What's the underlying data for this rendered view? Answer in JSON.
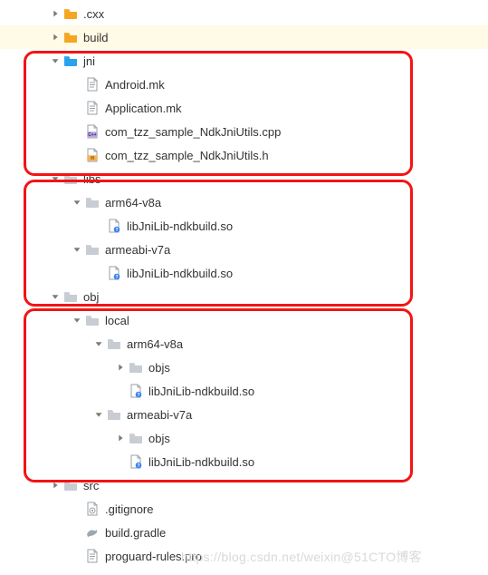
{
  "tree": [
    {
      "depth": 1,
      "toggle": "right",
      "iconKind": "folder-orange",
      "label": ".cxx",
      "interactable": true,
      "highlight": false
    },
    {
      "depth": 1,
      "toggle": "right",
      "iconKind": "folder-orange",
      "label": "build",
      "interactable": true,
      "highlight": true
    },
    {
      "depth": 1,
      "toggle": "down",
      "iconKind": "folder-blue",
      "label": "jni",
      "interactable": true,
      "highlight": false
    },
    {
      "depth": 2,
      "toggle": "none",
      "iconKind": "file-text",
      "label": "Android.mk",
      "interactable": true
    },
    {
      "depth": 2,
      "toggle": "none",
      "iconKind": "file-text",
      "label": "Application.mk",
      "interactable": true
    },
    {
      "depth": 2,
      "toggle": "none",
      "iconKind": "file-cpp",
      "label": "com_tzz_sample_NdkJniUtils.cpp",
      "interactable": true
    },
    {
      "depth": 2,
      "toggle": "none",
      "iconKind": "file-h",
      "label": "com_tzz_sample_NdkJniUtils.h",
      "interactable": true
    },
    {
      "depth": 1,
      "toggle": "down",
      "iconKind": "folder-grey",
      "label": "libs",
      "interactable": true
    },
    {
      "depth": 2,
      "toggle": "down",
      "iconKind": "folder-grey",
      "label": "arm64-v8a",
      "interactable": true
    },
    {
      "depth": 3,
      "toggle": "none",
      "iconKind": "file-so",
      "label": "libJniLib-ndkbuild.so",
      "interactable": true
    },
    {
      "depth": 2,
      "toggle": "down",
      "iconKind": "folder-grey",
      "label": "armeabi-v7a",
      "interactable": true
    },
    {
      "depth": 3,
      "toggle": "none",
      "iconKind": "file-so",
      "label": "libJniLib-ndkbuild.so",
      "interactable": true
    },
    {
      "depth": 1,
      "toggle": "down",
      "iconKind": "folder-grey",
      "label": "obj",
      "interactable": true
    },
    {
      "depth": 2,
      "toggle": "down",
      "iconKind": "folder-grey",
      "label": "local",
      "interactable": true
    },
    {
      "depth": 3,
      "toggle": "down",
      "iconKind": "folder-grey",
      "label": "arm64-v8a",
      "interactable": true
    },
    {
      "depth": 4,
      "toggle": "right",
      "iconKind": "folder-grey",
      "label": "objs",
      "interactable": true
    },
    {
      "depth": 4,
      "toggle": "none",
      "iconKind": "file-so",
      "label": "libJniLib-ndkbuild.so",
      "interactable": true
    },
    {
      "depth": 3,
      "toggle": "down",
      "iconKind": "folder-grey",
      "label": "armeabi-v7a",
      "interactable": true
    },
    {
      "depth": 4,
      "toggle": "right",
      "iconKind": "folder-grey",
      "label": "objs",
      "interactable": true
    },
    {
      "depth": 4,
      "toggle": "none",
      "iconKind": "file-so",
      "label": "libJniLib-ndkbuild.so",
      "interactable": true
    },
    {
      "depth": 1,
      "toggle": "right",
      "iconKind": "folder-grey",
      "label": "src",
      "interactable": true
    },
    {
      "depth": 2,
      "toggle": "none",
      "iconKind": "file-gitignore",
      "label": ".gitignore",
      "interactable": true
    },
    {
      "depth": 2,
      "toggle": "none",
      "iconKind": "file-gradle",
      "label": "build.gradle",
      "interactable": true
    },
    {
      "depth": 2,
      "toggle": "none",
      "iconKind": "file-proguard",
      "label": "proguard-rules.pro",
      "interactable": true
    }
  ],
  "watermark": "https://blog.csdn.net/weixin@51CTO博客"
}
